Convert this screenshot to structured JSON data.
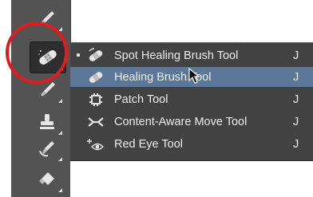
{
  "toolbar": {
    "tools": [
      {
        "icon": "brush-tool-icon"
      },
      {
        "icon": "healing-brush-icon",
        "active": true
      },
      {
        "icon": "brush-tool-icon"
      },
      {
        "icon": "clone-stamp-icon"
      },
      {
        "icon": "history-brush-icon"
      },
      {
        "icon": "eraser-icon"
      }
    ]
  },
  "flyout_menu": {
    "items": [
      {
        "label": "Spot Healing Brush Tool",
        "shortcut": "J",
        "icon": "spot-healing-brush-icon",
        "current": true
      },
      {
        "label": "Healing Brush Tool",
        "shortcut": "J",
        "icon": "healing-brush-icon",
        "highlighted": true
      },
      {
        "label": "Patch Tool",
        "shortcut": "J",
        "icon": "patch-tool-icon"
      },
      {
        "label": "Content-Aware Move Tool",
        "shortcut": "J",
        "icon": "content-aware-move-icon"
      },
      {
        "label": "Red Eye Tool",
        "shortcut": "J",
        "icon": "red-eye-icon"
      }
    ]
  },
  "colors": {
    "toolbar_bg": "#535353",
    "menu_bg": "#424242",
    "highlight_bg": "#5c7898",
    "annotation_ring": "#e3191c"
  }
}
